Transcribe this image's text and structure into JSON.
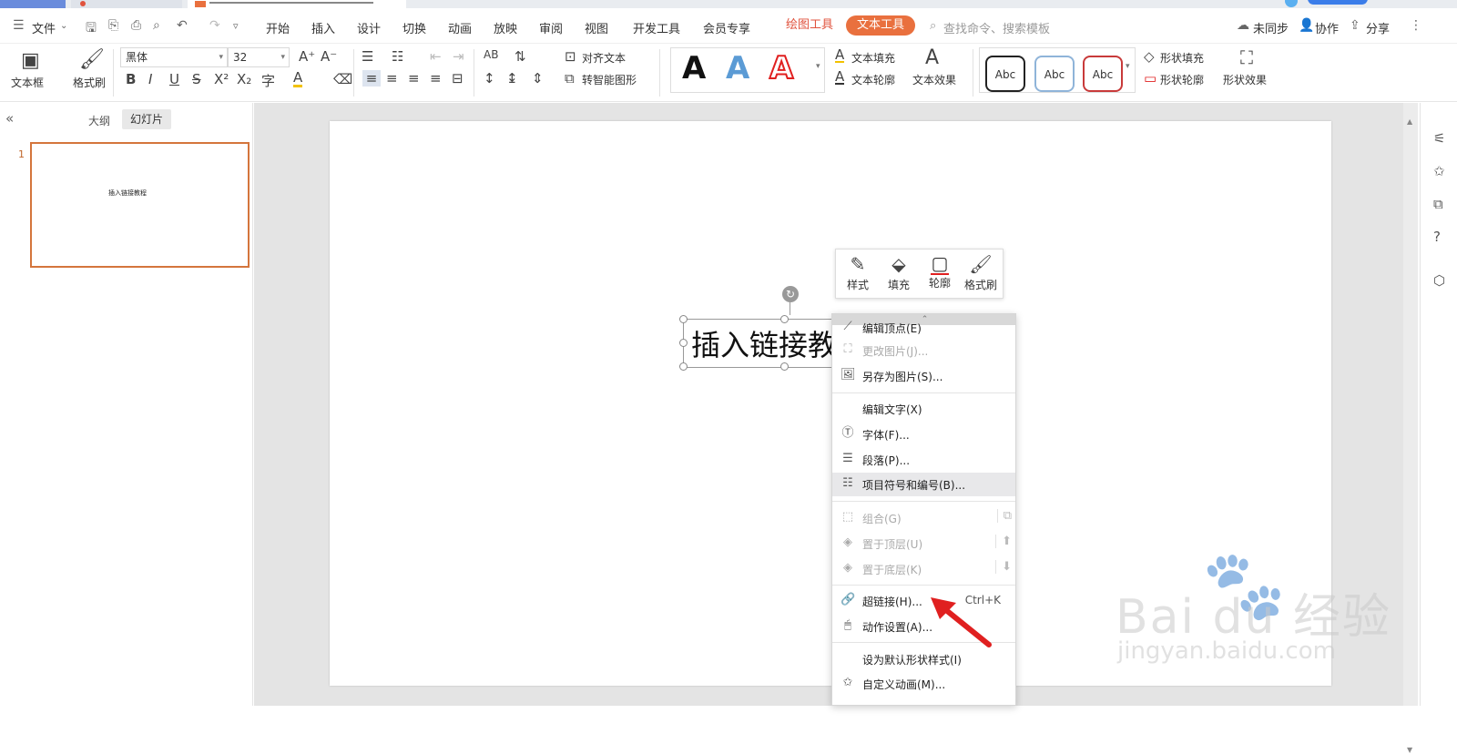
{
  "menubar": {
    "file": "文件",
    "items": [
      "开始",
      "插入",
      "设计",
      "切换",
      "动画",
      "放映",
      "审阅",
      "视图",
      "开发工具",
      "会员专享"
    ],
    "ctx_tab_drawing": "绘图工具",
    "ctx_tab_text": "文本工具",
    "search_placeholder": "查找命令、搜索模板",
    "sync": "未同步",
    "collab": "协作",
    "share": "分享"
  },
  "ribbon": {
    "textbox": "文本框",
    "format_painter": "格式刷",
    "font_name": "黑体",
    "font_size": "32",
    "align_text": "对齐文本",
    "smart_art": "转智能图形",
    "text_fill": "文本填充",
    "text_outline": "文本轮廓",
    "text_effect": "文本效果",
    "abc1": "Abc",
    "abc2": "Abc",
    "abc3": "Abc",
    "shape_fill": "形状填充",
    "shape_outline": "形状轮廓",
    "shape_effect": "形状效果"
  },
  "leftpanel": {
    "outline_tab": "大纲",
    "slides_tab": "幻灯片",
    "slide_number": "1",
    "thumb_text": "插入链接教程"
  },
  "slide": {
    "textbox_text": "插入链接教程"
  },
  "floatbar": {
    "style": "样式",
    "fill": "填充",
    "outline": "轮廓",
    "painter": "格式刷"
  },
  "context_menu": {
    "edit_points": "编辑顶点(E)",
    "change_picture": "更改图片(J)...",
    "save_as_picture": "另存为图片(S)...",
    "edit_text": "编辑文字(X)",
    "font": "字体(F)...",
    "paragraph": "段落(P)...",
    "bullets": "项目符号和编号(B)...",
    "group": "组合(G)",
    "bring_to_front": "置于顶层(U)",
    "send_to_back": "置于底层(K)",
    "hyperlink": "超链接(H)...",
    "hyperlink_shortcut": "Ctrl+K",
    "action_settings": "动作设置(A)...",
    "set_default_style": "设为默认形状样式(I)",
    "custom_animation": "自定义动画(M)..."
  },
  "watermark": {
    "brand": "Bai du 经验",
    "url": "jingyan.baidu.com"
  },
  "colors": {
    "accent_orange": "#e9703e",
    "drawing_tab": "#e0533e",
    "selection_border": "#d4753c",
    "arrow_red": "#e02020"
  }
}
